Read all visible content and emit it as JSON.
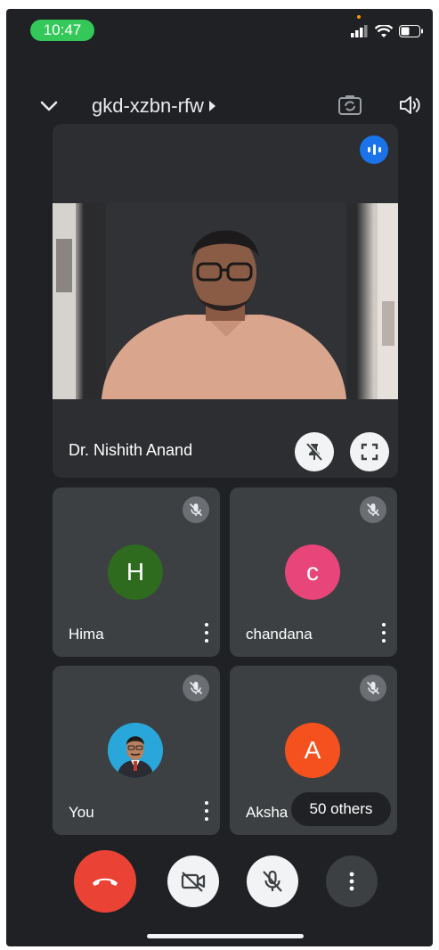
{
  "status_bar": {
    "time": "10:47"
  },
  "header": {
    "meeting_code": "gkd-xzbn-rfw"
  },
  "main_tile": {
    "participant_name": "Dr. Nishith Anand"
  },
  "participants": [
    {
      "name": "Hima",
      "initial": "H",
      "color": "#2e6b1f"
    },
    {
      "name": "chandana",
      "initial": "c",
      "color": "#e8457a"
    },
    {
      "name": "You"
    },
    {
      "name": "Aksha",
      "initial": "A",
      "color": "#f4511e"
    }
  ],
  "others_label": "50 others",
  "colors": {
    "end_call": "#ea4335",
    "speaking": "#1a73e8",
    "background": "#202124",
    "tile": "#3c4043"
  }
}
